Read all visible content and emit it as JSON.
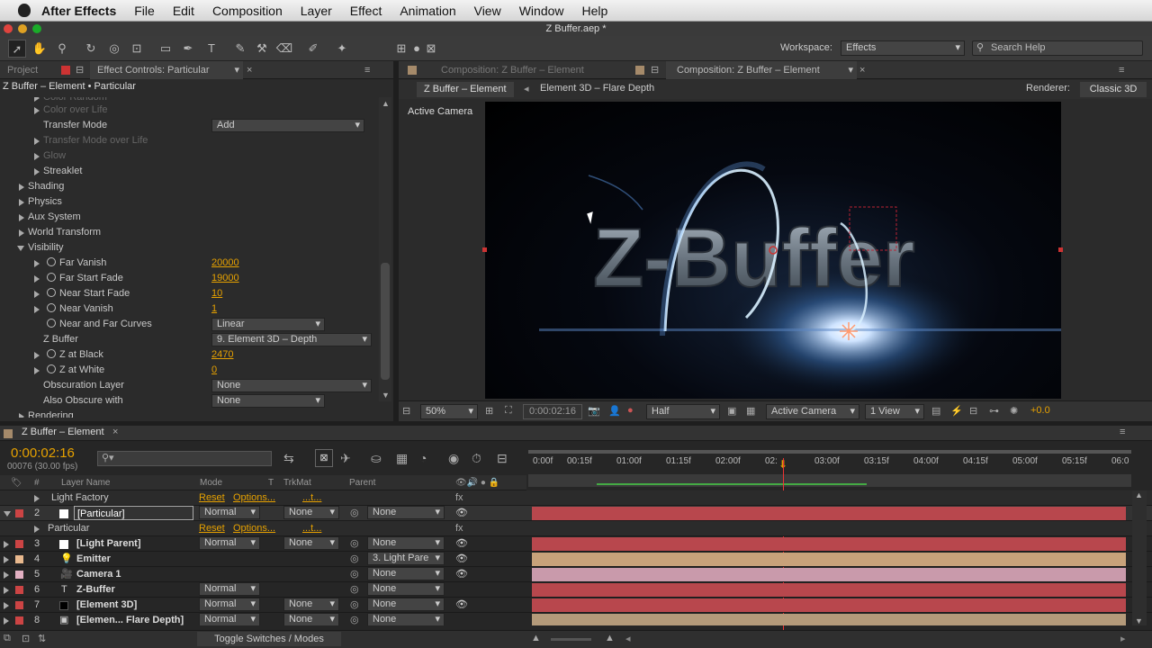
{
  "menubar": {
    "app": "After Effects",
    "items": [
      "File",
      "Edit",
      "Composition",
      "Layer",
      "Effect",
      "Animation",
      "View",
      "Window",
      "Help"
    ]
  },
  "window": {
    "title": "Z Buffer.aep *"
  },
  "toolbar": {
    "workspace_label": "Workspace:",
    "workspace_value": "Effects",
    "search_placeholder": "Search Help"
  },
  "left_panel": {
    "tab_project": "Project",
    "tab_effect": "Effect Controls: Particular",
    "breadcrumb": "Z Buffer – Element • Particular",
    "rows": [
      {
        "label": "Color Random",
        "dim": true
      },
      {
        "label": "Color over Life",
        "dim": true
      },
      {
        "label": "Transfer Mode",
        "value": "Add"
      },
      {
        "label": "Transfer Mode over Life",
        "dim": true
      },
      {
        "label": "Glow",
        "dim": true
      },
      {
        "label": "Streaklet"
      },
      {
        "label": "Shading"
      },
      {
        "label": "Physics"
      },
      {
        "label": "Aux System"
      },
      {
        "label": "World Transform"
      },
      {
        "label": "Visibility"
      },
      {
        "label": "Far Vanish",
        "value": "20000"
      },
      {
        "label": "Far Start Fade",
        "value": "19000"
      },
      {
        "label": "Near Start Fade",
        "value": "10"
      },
      {
        "label": "Near Vanish",
        "value": "1"
      },
      {
        "label": "Near and Far Curves",
        "value": "Linear"
      },
      {
        "label": "Z Buffer",
        "value": "9. Element 3D – Depth"
      },
      {
        "label": "Z at Black",
        "value": "2470"
      },
      {
        "label": "Z at White",
        "value": "0"
      },
      {
        "label": "Obscuration Layer",
        "value": "None"
      },
      {
        "label": "Also Obscure with",
        "value": "None"
      },
      {
        "label": "Rendering"
      }
    ]
  },
  "comp": {
    "tab_inactive": "Composition: Z Buffer – Element",
    "tab_active": "Composition: Z Buffer – Element",
    "crumb1": "Z Buffer – Element",
    "crumb2": "Element 3D – Flare Depth",
    "renderer_label": "Renderer:",
    "renderer_value": "Classic 3D",
    "active_camera": "Active Camera",
    "logo_text": "Z-Buffer",
    "zoom": "50%",
    "timecode": "0:00:02:16",
    "resolution": "Half",
    "view_camera": "Active Camera",
    "views": "1 View",
    "exposure": "+0.0"
  },
  "timeline": {
    "tab": "Z Buffer – Element",
    "timecode": "0:00:02:16",
    "frame_info": "00076 (30.00 fps)",
    "col_num": "#",
    "col_layer": "Layer Name",
    "col_mode": "Mode",
    "col_t": "T",
    "col_trkmat": "TrkMat",
    "col_parent": "Parent",
    "ruler": [
      "0:00f",
      "00:15f",
      "01:00f",
      "01:15f",
      "02:00f",
      "02:",
      "03:00f",
      "03:15f",
      "04:00f",
      "04:15f",
      "05:00f",
      "05:15f",
      "06:0"
    ],
    "effect_reset": "Reset",
    "effect_options": "Options...",
    "effect_t": "...t...",
    "light_factory": "Light Factory",
    "particular_fx": "Particular",
    "layers": [
      {
        "num": "2",
        "name": "[Particular]",
        "mode": "Normal",
        "trkmat": "None",
        "parent": "None",
        "color": "#c44",
        "bar": "#b8474d"
      },
      {
        "num": "3",
        "name": "[Light Parent]",
        "mode": "Normal",
        "trkmat": "None",
        "parent": "None",
        "color": "#c44",
        "bar": "#b8474d"
      },
      {
        "num": "4",
        "name": "Emitter",
        "mode": "",
        "trkmat": "",
        "parent": "3. Light Pare",
        "color": "#e9b98e",
        "bar": "#c8a27a"
      },
      {
        "num": "5",
        "name": "Camera 1",
        "mode": "",
        "trkmat": "",
        "parent": "None",
        "color": "#e2b0c2",
        "bar": "#c99aab"
      },
      {
        "num": "6",
        "name": "Z-Buffer",
        "mode": "Normal",
        "trkmat": "",
        "parent": "None",
        "color": "#c44",
        "bar": "#b8474d"
      },
      {
        "num": "7",
        "name": "[Element 3D]",
        "mode": "Normal",
        "trkmat": "None",
        "parent": "None",
        "color": "#c44",
        "bar": "#b8474d"
      },
      {
        "num": "8",
        "name": "[Elemen... Flare Depth]",
        "mode": "Normal",
        "trkmat": "None",
        "parent": "None",
        "color": "#c44",
        "bar": "#b49a7a"
      }
    ],
    "toggle_label": "Toggle Switches / Modes"
  }
}
